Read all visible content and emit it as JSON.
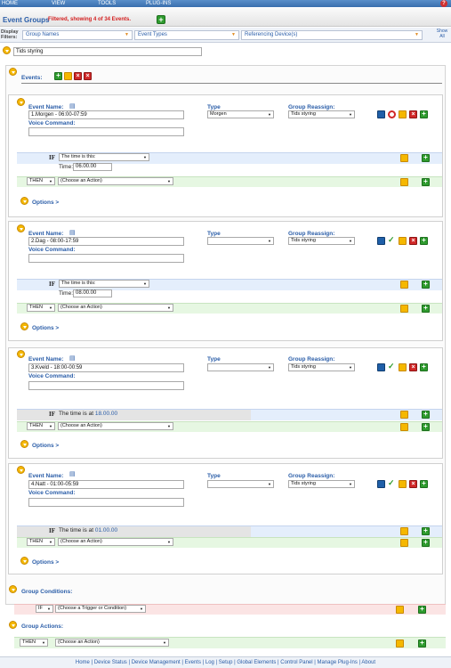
{
  "menu": [
    "HOME",
    "VIEW",
    "TOOLS",
    "PLUG-INS"
  ],
  "header": {
    "title": "Event Groups",
    "filter_status": "Filtered, showing 4 of 34 Events."
  },
  "filters": {
    "label": "Display Filters:",
    "group_names": "Group Names",
    "event_types": "Event Types",
    "referencing_device": "Referencing Device(s)",
    "show_all": "Show All"
  },
  "group_name_value": "Tids styring",
  "events_label": "Events:",
  "event_labels": {
    "event_name": "Event Name:",
    "type": "Type",
    "group_reassign": "Group Reassign:",
    "voice_command": "Voice Command:",
    "options": "Options >",
    "if": "IF",
    "then": "THEN",
    "choose_action": "(Choose an Action)",
    "time_label": "Time:"
  },
  "events": [
    {
      "name": "1.Morgen - 06:00-07:59",
      "type": "Morgen",
      "group": "Tids styring",
      "if_select": "The time is this:",
      "time": "06.00.00",
      "if_text": ""
    },
    {
      "name": "2.Dag - 08:00-17:59",
      "type": "",
      "group": "Tids styring",
      "if_select": "The time is this:",
      "time": "08.00.00",
      "if_text": ""
    },
    {
      "name": "3.Kveld - 18:00-00:59",
      "type": "",
      "group": "Tids styring",
      "if_select": "",
      "time": "",
      "if_text": "The time is at ",
      "if_time": "18.00.00"
    },
    {
      "name": "4.Natt - 01:00-05:59",
      "type": "",
      "group": "Tids styring",
      "if_select": "",
      "time": "",
      "if_text": "The time is at ",
      "if_time": "01.00.00"
    }
  ],
  "group_conditions": {
    "label": "Group Conditions:",
    "if": "IF",
    "choose": "(Choose a Trigger or Condition)"
  },
  "group_actions": {
    "label": "Group Actions:",
    "then": "THEN",
    "choose": "(Choose an Action)"
  },
  "footer": "Home | Device Status | Device Management | Events | Log | Setup | Global Elements | Control Panel | Manage Plug-Ins | About",
  "colors": {
    "accent": "#2a5da8",
    "filter_red": "#d42020",
    "menu": "#3a6fae"
  }
}
